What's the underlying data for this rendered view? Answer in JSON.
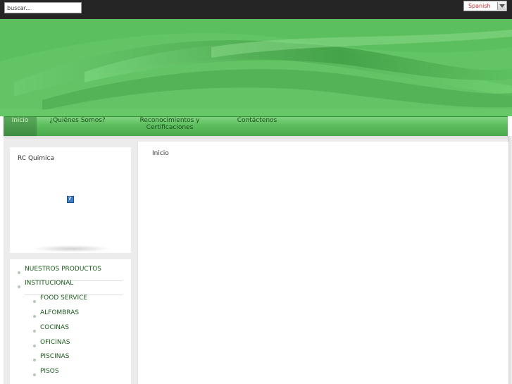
{
  "topbar": {
    "search_value": "buscar...",
    "language_selected": "Spanish"
  },
  "nav": {
    "items": [
      "Inicio",
      "¿Quiénes Somos?",
      "Reconocimientos y Certificaciones",
      "Contáctenos"
    ],
    "active_index": 0
  },
  "sidebar": {
    "brand_title": "RC Quimica",
    "broken_image_glyph": "?",
    "menu": [
      {
        "label": "NUESTROS PRODUCTOS",
        "level": 1
      },
      {
        "label": "INSTITUCIONAL",
        "level": 1
      },
      {
        "label": "FOOD SERVICE",
        "level": 2
      },
      {
        "label": "ALFOMBRAS",
        "level": 2
      },
      {
        "label": "COCINAS",
        "level": 2
      },
      {
        "label": "OFICINAS",
        "level": 2
      },
      {
        "label": "PISCINAS",
        "level": 2
      },
      {
        "label": "PISOS",
        "level": 2
      }
    ]
  },
  "main": {
    "page_label": "Inicio"
  },
  "colors": {
    "topbar": "#252525",
    "banner_green": "#5cbf5e",
    "nav_green": "#5bbd5c",
    "link_green": "#1c5a1c"
  }
}
